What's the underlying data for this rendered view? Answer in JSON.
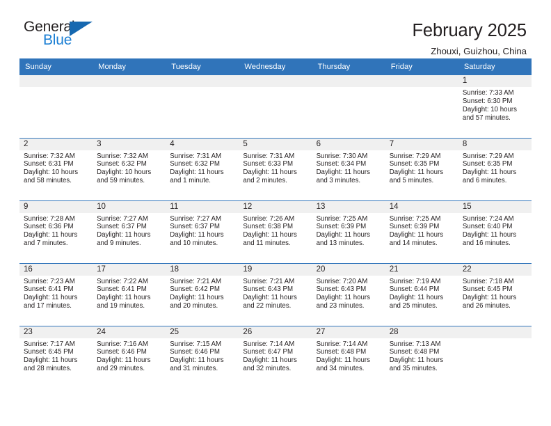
{
  "brand": {
    "name_part1": "General",
    "name_part2": "Blue",
    "accent_color": "#1668b0",
    "blue_text_color": "#1b7fd4"
  },
  "header": {
    "month_title": "February 2025",
    "location": "Zhouxi, Guizhou, China"
  },
  "theme": {
    "header_blue": "#3074ba",
    "band_gray": "#f0f0f0",
    "text": "#231f20"
  },
  "weekdays": [
    "Sunday",
    "Monday",
    "Tuesday",
    "Wednesday",
    "Thursday",
    "Friday",
    "Saturday"
  ],
  "weeks": [
    [
      {
        "day": "",
        "sunrise": "",
        "sunset": "",
        "daylight": "",
        "empty": true
      },
      {
        "day": "",
        "sunrise": "",
        "sunset": "",
        "daylight": "",
        "empty": true
      },
      {
        "day": "",
        "sunrise": "",
        "sunset": "",
        "daylight": "",
        "empty": true
      },
      {
        "day": "",
        "sunrise": "",
        "sunset": "",
        "daylight": "",
        "empty": true
      },
      {
        "day": "",
        "sunrise": "",
        "sunset": "",
        "daylight": "",
        "empty": true
      },
      {
        "day": "",
        "sunrise": "",
        "sunset": "",
        "daylight": "",
        "empty": true
      },
      {
        "day": "1",
        "sunrise": "Sunrise: 7:33 AM",
        "sunset": "Sunset: 6:30 PM",
        "daylight": "Daylight: 10 hours and 57 minutes."
      }
    ],
    [
      {
        "day": "2",
        "sunrise": "Sunrise: 7:32 AM",
        "sunset": "Sunset: 6:31 PM",
        "daylight": "Daylight: 10 hours and 58 minutes."
      },
      {
        "day": "3",
        "sunrise": "Sunrise: 7:32 AM",
        "sunset": "Sunset: 6:32 PM",
        "daylight": "Daylight: 10 hours and 59 minutes."
      },
      {
        "day": "4",
        "sunrise": "Sunrise: 7:31 AM",
        "sunset": "Sunset: 6:32 PM",
        "daylight": "Daylight: 11 hours and 1 minute."
      },
      {
        "day": "5",
        "sunrise": "Sunrise: 7:31 AM",
        "sunset": "Sunset: 6:33 PM",
        "daylight": "Daylight: 11 hours and 2 minutes."
      },
      {
        "day": "6",
        "sunrise": "Sunrise: 7:30 AM",
        "sunset": "Sunset: 6:34 PM",
        "daylight": "Daylight: 11 hours and 3 minutes."
      },
      {
        "day": "7",
        "sunrise": "Sunrise: 7:29 AM",
        "sunset": "Sunset: 6:35 PM",
        "daylight": "Daylight: 11 hours and 5 minutes."
      },
      {
        "day": "8",
        "sunrise": "Sunrise: 7:29 AM",
        "sunset": "Sunset: 6:35 PM",
        "daylight": "Daylight: 11 hours and 6 minutes."
      }
    ],
    [
      {
        "day": "9",
        "sunrise": "Sunrise: 7:28 AM",
        "sunset": "Sunset: 6:36 PM",
        "daylight": "Daylight: 11 hours and 7 minutes."
      },
      {
        "day": "10",
        "sunrise": "Sunrise: 7:27 AM",
        "sunset": "Sunset: 6:37 PM",
        "daylight": "Daylight: 11 hours and 9 minutes."
      },
      {
        "day": "11",
        "sunrise": "Sunrise: 7:27 AM",
        "sunset": "Sunset: 6:37 PM",
        "daylight": "Daylight: 11 hours and 10 minutes."
      },
      {
        "day": "12",
        "sunrise": "Sunrise: 7:26 AM",
        "sunset": "Sunset: 6:38 PM",
        "daylight": "Daylight: 11 hours and 11 minutes."
      },
      {
        "day": "13",
        "sunrise": "Sunrise: 7:25 AM",
        "sunset": "Sunset: 6:39 PM",
        "daylight": "Daylight: 11 hours and 13 minutes."
      },
      {
        "day": "14",
        "sunrise": "Sunrise: 7:25 AM",
        "sunset": "Sunset: 6:39 PM",
        "daylight": "Daylight: 11 hours and 14 minutes."
      },
      {
        "day": "15",
        "sunrise": "Sunrise: 7:24 AM",
        "sunset": "Sunset: 6:40 PM",
        "daylight": "Daylight: 11 hours and 16 minutes."
      }
    ],
    [
      {
        "day": "16",
        "sunrise": "Sunrise: 7:23 AM",
        "sunset": "Sunset: 6:41 PM",
        "daylight": "Daylight: 11 hours and 17 minutes."
      },
      {
        "day": "17",
        "sunrise": "Sunrise: 7:22 AM",
        "sunset": "Sunset: 6:41 PM",
        "daylight": "Daylight: 11 hours and 19 minutes."
      },
      {
        "day": "18",
        "sunrise": "Sunrise: 7:21 AM",
        "sunset": "Sunset: 6:42 PM",
        "daylight": "Daylight: 11 hours and 20 minutes."
      },
      {
        "day": "19",
        "sunrise": "Sunrise: 7:21 AM",
        "sunset": "Sunset: 6:43 PM",
        "daylight": "Daylight: 11 hours and 22 minutes."
      },
      {
        "day": "20",
        "sunrise": "Sunrise: 7:20 AM",
        "sunset": "Sunset: 6:43 PM",
        "daylight": "Daylight: 11 hours and 23 minutes."
      },
      {
        "day": "21",
        "sunrise": "Sunrise: 7:19 AM",
        "sunset": "Sunset: 6:44 PM",
        "daylight": "Daylight: 11 hours and 25 minutes."
      },
      {
        "day": "22",
        "sunrise": "Sunrise: 7:18 AM",
        "sunset": "Sunset: 6:45 PM",
        "daylight": "Daylight: 11 hours and 26 minutes."
      }
    ],
    [
      {
        "day": "23",
        "sunrise": "Sunrise: 7:17 AM",
        "sunset": "Sunset: 6:45 PM",
        "daylight": "Daylight: 11 hours and 28 minutes."
      },
      {
        "day": "24",
        "sunrise": "Sunrise: 7:16 AM",
        "sunset": "Sunset: 6:46 PM",
        "daylight": "Daylight: 11 hours and 29 minutes."
      },
      {
        "day": "25",
        "sunrise": "Sunrise: 7:15 AM",
        "sunset": "Sunset: 6:46 PM",
        "daylight": "Daylight: 11 hours and 31 minutes."
      },
      {
        "day": "26",
        "sunrise": "Sunrise: 7:14 AM",
        "sunset": "Sunset: 6:47 PM",
        "daylight": "Daylight: 11 hours and 32 minutes."
      },
      {
        "day": "27",
        "sunrise": "Sunrise: 7:14 AM",
        "sunset": "Sunset: 6:48 PM",
        "daylight": "Daylight: 11 hours and 34 minutes."
      },
      {
        "day": "28",
        "sunrise": "Sunrise: 7:13 AM",
        "sunset": "Sunset: 6:48 PM",
        "daylight": "Daylight: 11 hours and 35 minutes."
      },
      {
        "day": "",
        "sunrise": "",
        "sunset": "",
        "daylight": "",
        "empty": true
      }
    ]
  ]
}
